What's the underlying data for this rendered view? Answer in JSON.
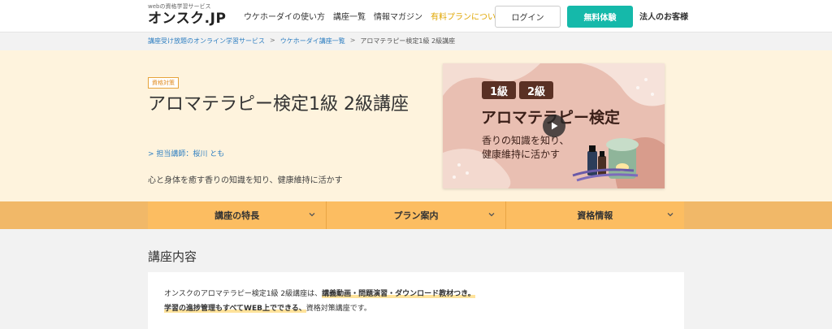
{
  "header": {
    "logo_tagline": "webの資格学習サービス",
    "logo_name": "オンスク.JP",
    "nav": [
      {
        "label": "ウケホーダイの使い方"
      },
      {
        "label": "講座一覧"
      },
      {
        "label": "情報マガジン"
      },
      {
        "label": "有料プランについて"
      }
    ],
    "login_label": "ログイン",
    "free_trial_label": "無料体験",
    "corporate_label": "法人のお客様"
  },
  "breadcrumb": {
    "items": [
      "講座受け放題のオンライン学習サービス",
      "ウケホーダイ講座一覧",
      "アロマテラピー検定1級 2級講座"
    ],
    "separator": ">"
  },
  "hero": {
    "badge": "資格対策",
    "title": "アロマテラピー検定1級 2級講座",
    "instructor": "> 担当講師：桜川 とも",
    "subtitle": "心と身体を癒す香りの知識を知り、健康維持に活かす",
    "thumbnail": {
      "level1": "1級",
      "level2": "2級",
      "title": "アロマテラピー検定",
      "line1": "香りの知識を知り、",
      "line2": "健康維持に活かす",
      "play_icon": "play-icon"
    }
  },
  "tabs": [
    {
      "label": "講座の特長"
    },
    {
      "label": "プラン案内"
    },
    {
      "label": "資格情報"
    }
  ],
  "content": {
    "section_title": "講座内容",
    "intro_plain1": "オンスクのアロマテラピー検定1級 2級講座は、",
    "intro_highlight1": "講義動画・問題演習・ダウンロード教材つき。",
    "intro_highlight2": "学習の進捗管理もすべてWEB上でできる、",
    "intro_plain2": "資格対策講座です。"
  },
  "colors": {
    "accent_teal": "#15b9aa",
    "hero_bg": "#fef3dd",
    "tab_bg": "#fcbd61",
    "link_blue": "#2f7fc1",
    "paid_plan": "#e0a600"
  }
}
